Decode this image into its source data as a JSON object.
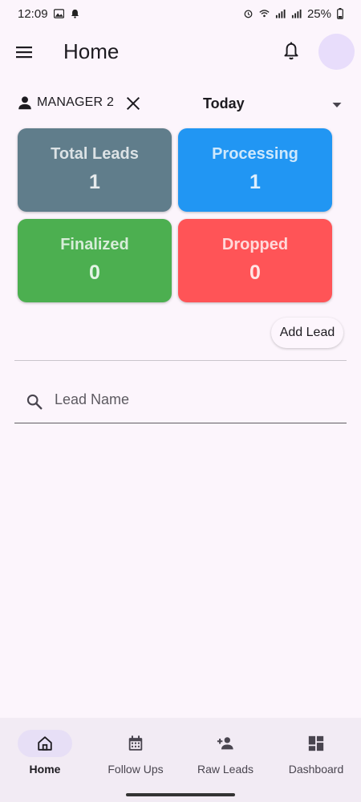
{
  "status_bar": {
    "time": "12:09",
    "battery": "25%",
    "icons": [
      "image-icon",
      "notification-bell-icon",
      "alarm-icon",
      "wifi-icon",
      "signal-icon",
      "battery-icon"
    ]
  },
  "app_bar": {
    "title": "Home",
    "menu_icon": "menu-icon",
    "notification_icon": "bell-icon"
  },
  "filter": {
    "manager": "MANAGER 2",
    "date_range": "Today"
  },
  "stats": [
    {
      "label": "Total Leads",
      "value": "1",
      "color": "#607d8b"
    },
    {
      "label": "Processing",
      "value": "1",
      "color": "#2196f3"
    },
    {
      "label": "Finalized",
      "value": "0",
      "color": "#4caf50"
    },
    {
      "label": "Dropped",
      "value": "0",
      "color": "#ff5457"
    }
  ],
  "add_lead_label": "Add Lead",
  "search": {
    "placeholder": "Lead Name",
    "value": ""
  },
  "bottom_nav": {
    "items": [
      {
        "label": "Home",
        "icon": "home-icon",
        "active": true
      },
      {
        "label": "Follow Ups",
        "icon": "calendar-icon",
        "active": false
      },
      {
        "label": "Raw Leads",
        "icon": "person-add-icon",
        "active": false
      },
      {
        "label": "Dashboard",
        "icon": "dashboard-icon",
        "active": false
      }
    ]
  },
  "colors": {
    "background": "#fcf5fc",
    "nav_background": "#f2ebf4",
    "active_pill": "#e7dff6",
    "avatar": "#e8ddfb"
  }
}
